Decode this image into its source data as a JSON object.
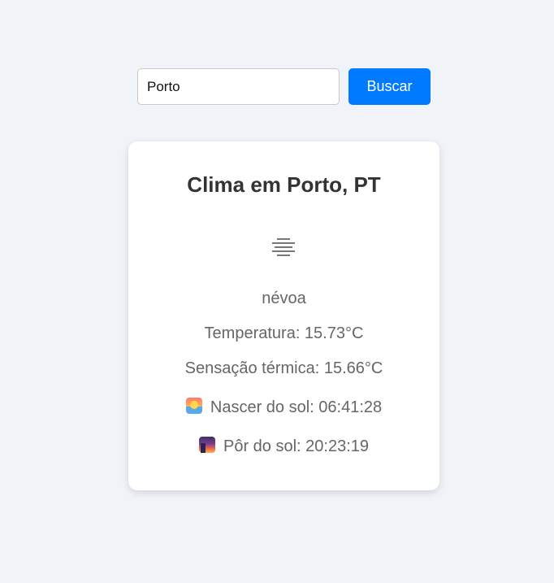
{
  "search": {
    "value": "Porto",
    "button_label": "Buscar"
  },
  "weather": {
    "title": "Clima em Porto, PT",
    "icon": "mist-icon",
    "description": "névoa",
    "temperature": "Temperatura: 15.73°C",
    "feels_like": "Sensação térmica: 15.66°C",
    "sunrise": "Nascer do sol: 06:41:28",
    "sunset": "Pôr do sol: 20:23:19"
  },
  "colors": {
    "background": "#f0f3f8",
    "button": "#007bff",
    "title": "#333333",
    "text": "#666666"
  }
}
